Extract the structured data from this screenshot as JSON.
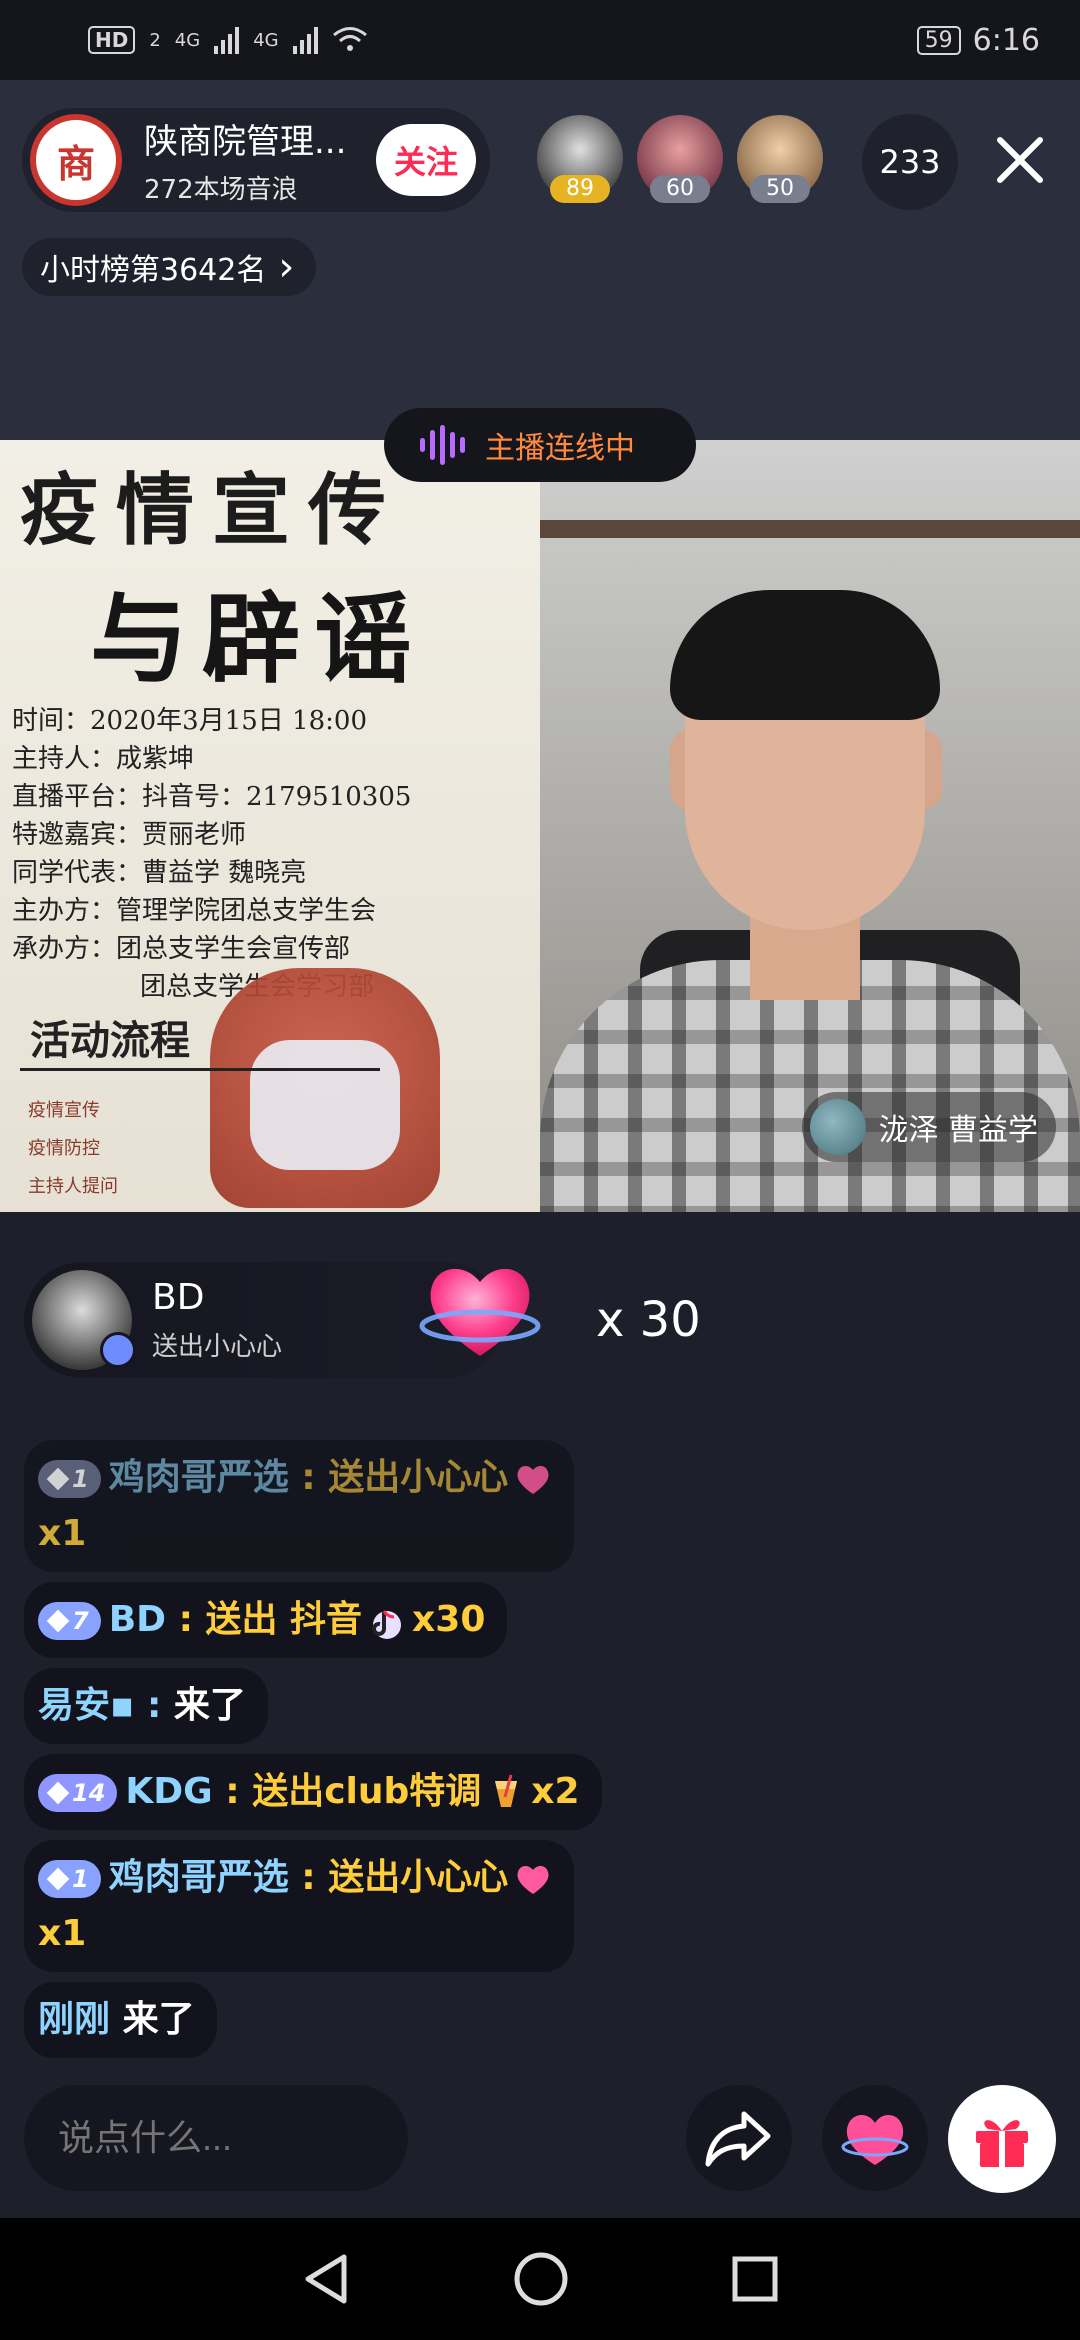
{
  "status_bar": {
    "hd_label": "HD",
    "hd_sub": "2",
    "net1": "4G",
    "net2": "4G",
    "battery": "59",
    "time": "6:16"
  },
  "host": {
    "avatar_char": "商",
    "name": "陕商院管理...",
    "subtitle": "272本场音浪",
    "follow_label": "关注"
  },
  "viewers": [
    {
      "level": "89",
      "color": "#e6b422"
    },
    {
      "level": "60",
      "color": "#7a7f90"
    },
    {
      "level": "50",
      "color": "#7a7f90"
    }
  ],
  "viewer_count": "233",
  "rank": {
    "label": "小时榜第3642名",
    "arrow": "›"
  },
  "linking_status": "主播连线中",
  "poster": {
    "title1": "疫情宣传",
    "title2": "与辟谣",
    "lines": [
      "时间：2020年3月15日 18:00",
      "主持人：成紫坤",
      "直播平台：抖音号：2179510305",
      "特邀嘉宾：贾丽老师",
      "同学代表：曹益学 魏晓亮",
      "主办方：管理学院团总支学生会",
      "承办方：团总支学生会宣传部",
      "团总支学生会学习部"
    ],
    "flow_heading": "活动流程",
    "flow_items": [
      "疫情宣传",
      "疫情防控",
      "主持人提问"
    ]
  },
  "guest_tag": "泷泽 曹益学",
  "gift_banner": {
    "user": "BD",
    "desc": "送出小心心",
    "count": "x 30"
  },
  "chat": [
    {
      "level": "1",
      "user": "鸡肉哥严选",
      "sep": " : ",
      "text": "送出小心心",
      "suffix": "x1",
      "faded": true
    },
    {
      "level": "7",
      "user": "BD",
      "sep": " : ",
      "text": "送出 抖音",
      "suffix": "x30",
      "faded": false
    },
    {
      "user": "易安▪",
      "sep": " : ",
      "text": "来了"
    },
    {
      "level": "14",
      "user": "KDG",
      "sep": " : ",
      "text": "送出club特调",
      "suffix": "x2"
    },
    {
      "level": "1",
      "user": "鸡肉哥严选",
      "sep": " : ",
      "text": "送出小心心",
      "suffix": "x1"
    },
    {
      "user": "刚刚",
      "text": "来了"
    }
  ],
  "input": {
    "placeholder": "说点什么..."
  },
  "colors": {
    "accent_red": "#fe2c55",
    "username": "#8fd3ff",
    "gift_text": "#ffcd3c",
    "linking": "#ff8a3d"
  }
}
